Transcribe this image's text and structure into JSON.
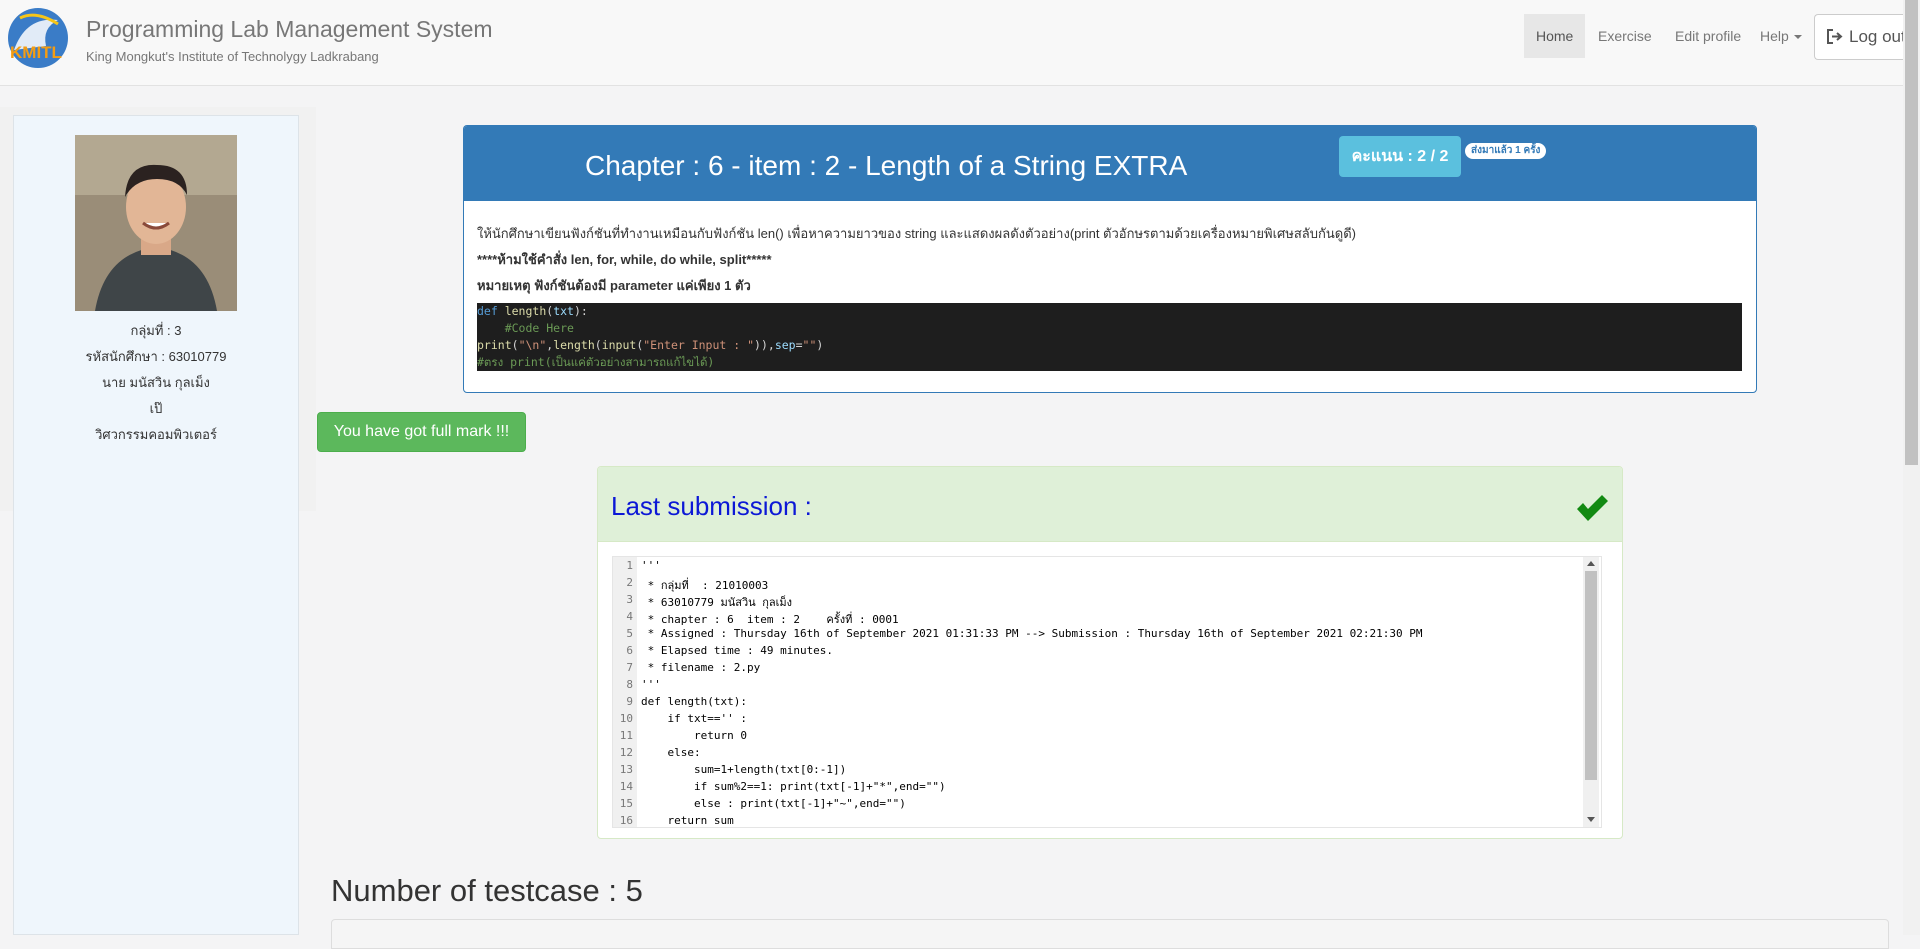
{
  "header": {
    "title": "Programming Lab Management System",
    "subtitle": "King Mongkut's Institute of Technolygy Ladkrabang",
    "logo_text": "KMITL",
    "nav": [
      {
        "label": "Home",
        "active": true
      },
      {
        "label": "Exercise"
      },
      {
        "label": "Edit profile"
      },
      {
        "label": "Help"
      }
    ],
    "logout_label": "Log out"
  },
  "profile": {
    "group": "กลุ่มที่ : 3",
    "student_id": "รหัสนักศึกษา : 63010779",
    "name": "นาย มนัสวิน กุลเม็ง",
    "nickname": "เป๊",
    "department": "วิศวกรรมคอมพิวเตอร์"
  },
  "problem": {
    "title": "Chapter : 6 - item : 2 - Length of a String EXTRA",
    "score": "คะแนน : 2 / 2",
    "submit_count": "ส่งมาแล้ว 1 ครั้ง",
    "description": "ให้นักศึกษาเขียนฟังก์ชันที่ทำงานเหมือนกับฟังก์ชัน len() เพื่อหาความยาวของ string และแสดงผลดังตัวอย่าง(print ตัวอักษรตามด้วยเครื่องหมายพิเศษสลับกันดูดี)",
    "rule": "****ห้ามใช้คำสั่ง len, for, while, do while, split*****",
    "note": "หมายเหตุ ฟังก์ชันต้องมี parameter แค่เพียง 1 ตัว",
    "code": {
      "l1_kw": "def ",
      "l1_fn": "length",
      "l1_open": "(",
      "l1_arg": "txt",
      "l1_close": "):",
      "l2": "    #Code Here",
      "l3_print": "print",
      "l3_a": "(",
      "l3_s1": "\"\\n\"",
      "l3_b": ",",
      "l3_len": "length",
      "l3_c": "(",
      "l3_input": "input",
      "l3_d": "(",
      "l3_s2": "\"Enter Input : \"",
      "l3_e": ")),",
      "l3_sep": "sep",
      "l3_f": "=",
      "l3_s3": "\"\"",
      "l3_g": ")",
      "l4": "#ตรง print(เป็นแค่ตัวอย่างสามารถแก้ไขได้)"
    }
  },
  "alert": {
    "full_mark": "You have got full mark !!!"
  },
  "submission": {
    "title": "Last submission :",
    "lines": [
      "'''",
      " * กลุ่มที่  : 21010003",
      " * 63010779 มนัสวิน กุลเม็ง",
      " * chapter : 6  item : 2    ครั้งที่ : 0001",
      " * Assigned : Thursday 16th of September 2021 01:31:33 PM --> Submission : Thursday 16th of September 2021 02:21:30 PM",
      " * Elapsed time : 49 minutes.",
      " * filename : 2.py",
      "'''",
      "def length(txt):",
      "    if txt=='' :",
      "        return 0",
      "    else:",
      "        sum=1+length(txt[0:-1])",
      "        if sum%2==1: print(txt[-1]+\"*\",end=\"\")",
      "        else : print(txt[-1]+\"~\",end=\"\")",
      "    return sum"
    ],
    "line_numbers": [
      "1",
      "2",
      "3",
      "4",
      "5",
      "6",
      "7",
      "8",
      "9",
      "10",
      "11",
      "12",
      "13",
      "14",
      "15",
      "16"
    ]
  },
  "testcase": {
    "title": "Number of testcase : 5"
  },
  "colors": {
    "primary": "#337ab7",
    "success": "#5cb85c",
    "info": "#5bc0de",
    "submission_title": "#0c18d6",
    "check": "#128a12"
  }
}
